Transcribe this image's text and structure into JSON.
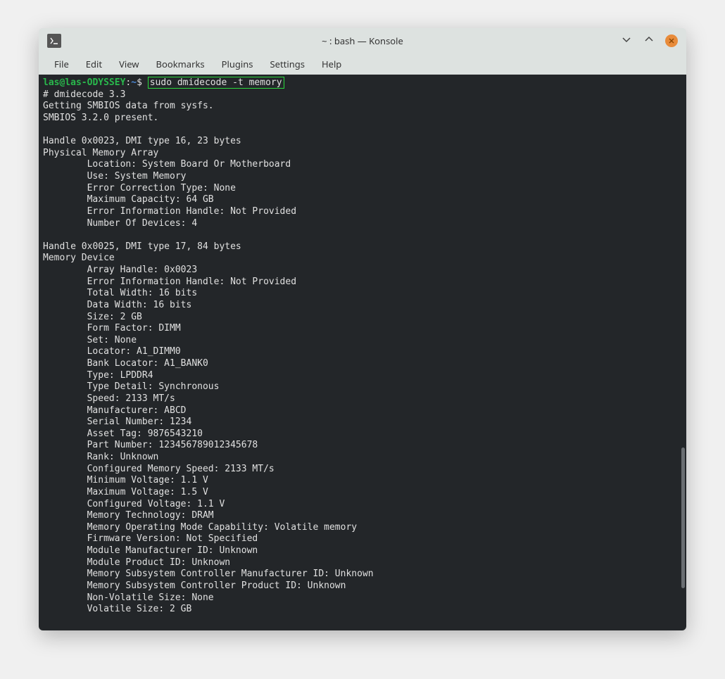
{
  "window": {
    "title": "~ : bash — Konsole"
  },
  "menubar": {
    "items": [
      "File",
      "Edit",
      "View",
      "Bookmarks",
      "Plugins",
      "Settings",
      "Help"
    ]
  },
  "prompt": {
    "user_host": "las@las-ODYSSEY",
    "sep": ":",
    "path": "~",
    "symbol": "$",
    "command": "sudo dmidecode -t memory"
  },
  "output": {
    "header": [
      "# dmidecode 3.3",
      "Getting SMBIOS data from sysfs.",
      "SMBIOS 3.2.0 present."
    ],
    "block1": {
      "head": [
        "Handle 0x0023, DMI type 16, 23 bytes",
        "Physical Memory Array"
      ],
      "props": [
        "Location: System Board Or Motherboard",
        "Use: System Memory",
        "Error Correction Type: None",
        "Maximum Capacity: 64 GB",
        "Error Information Handle: Not Provided",
        "Number Of Devices: 4"
      ]
    },
    "block2": {
      "head": [
        "Handle 0x0025, DMI type 17, 84 bytes",
        "Memory Device"
      ],
      "props": [
        "Array Handle: 0x0023",
        "Error Information Handle: Not Provided",
        "Total Width: 16 bits",
        "Data Width: 16 bits",
        "Size: 2 GB",
        "Form Factor: DIMM",
        "Set: None",
        "Locator: A1_DIMM0",
        "Bank Locator: A1_BANK0",
        "Type: LPDDR4",
        "Type Detail: Synchronous",
        "Speed: 2133 MT/s",
        "Manufacturer: ABCD",
        "Serial Number: 1234",
        "Asset Tag: 9876543210",
        "Part Number: 123456789012345678",
        "Rank: Unknown",
        "Configured Memory Speed: 2133 MT/s",
        "Minimum Voltage: 1.1 V",
        "Maximum Voltage: 1.5 V",
        "Configured Voltage: 1.1 V",
        "Memory Technology: DRAM",
        "Memory Operating Mode Capability: Volatile memory",
        "Firmware Version: Not Specified",
        "Module Manufacturer ID: Unknown",
        "Module Product ID: Unknown",
        "Memory Subsystem Controller Manufacturer ID: Unknown",
        "Memory Subsystem Controller Product ID: Unknown",
        "Non-Volatile Size: None",
        "Volatile Size: 2 GB"
      ]
    }
  }
}
